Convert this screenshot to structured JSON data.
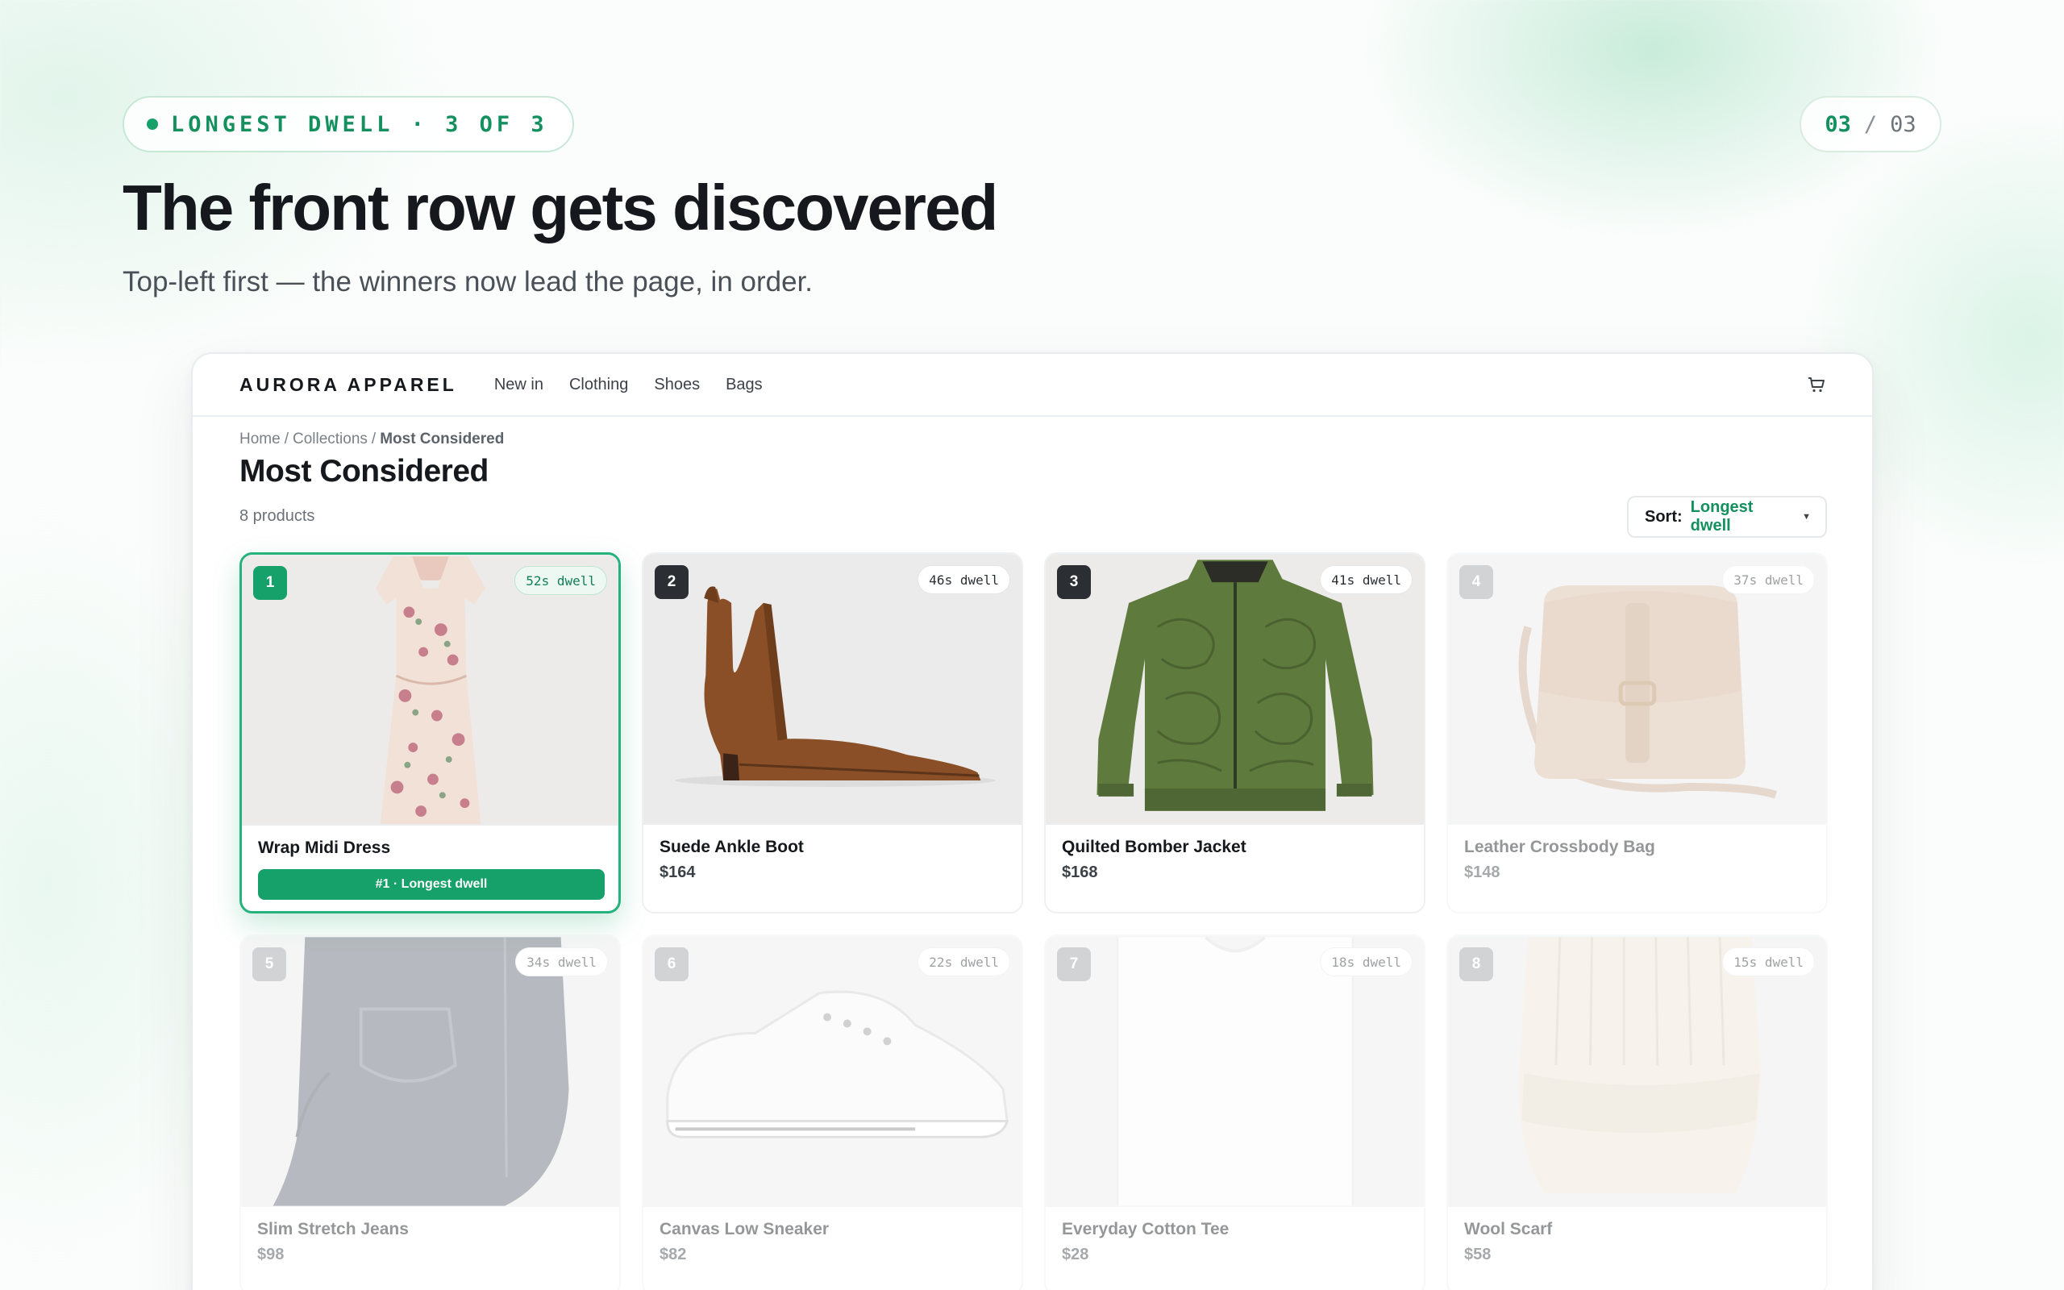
{
  "hero": {
    "step_label": "LONGEST DWELL · 3 OF 3",
    "counter_current": "03",
    "counter_separator": "/",
    "counter_total": "03",
    "title": "The front row gets discovered",
    "subtitle": "Top-left first — the winners now lead the page, in order."
  },
  "shop": {
    "brand": "AURORA APPAREL",
    "nav": [
      "New in",
      "Clothing",
      "Shoes",
      "Bags"
    ],
    "cart_icon": "cart-icon",
    "breadcrumb": [
      "Home",
      "Collections",
      "Most Considered"
    ],
    "breadcrumb_separator": "/",
    "page_title": "Most Considered",
    "product_count": "8 products",
    "sort_label": "Sort:",
    "sort_value": "Longest dwell",
    "products": [
      {
        "rank": "1",
        "dwell": "52s dwell",
        "name": "Wrap Midi Dress",
        "price": "",
        "tag": "#1 · Longest dwell",
        "image": "floral-dress"
      },
      {
        "rank": "2",
        "dwell": "46s dwell",
        "name": "Suede Ankle Boot",
        "price": "$164",
        "image": "ankle-boot"
      },
      {
        "rank": "3",
        "dwell": "41s dwell",
        "name": "Quilted Bomber Jacket",
        "price": "$168",
        "image": "bomber-jacket"
      },
      {
        "rank": "4",
        "dwell": "37s dwell",
        "name": "Leather Crossbody Bag",
        "price": "$148",
        "image": "crossbody-bag"
      },
      {
        "rank": "5",
        "dwell": "34s dwell",
        "name": "Slim Stretch Jeans",
        "price": "$98",
        "image": "jeans"
      },
      {
        "rank": "6",
        "dwell": "22s dwell",
        "name": "Canvas Low Sneaker",
        "price": "$82",
        "image": "sneaker"
      },
      {
        "rank": "7",
        "dwell": "18s dwell",
        "name": "Everyday Cotton Tee",
        "price": "$28",
        "image": "tee"
      },
      {
        "rank": "8",
        "dwell": "15s dwell",
        "name": "Wool Scarf",
        "price": "$58",
        "image": "scarf"
      }
    ]
  },
  "colors": {
    "accent_green": "#16a06a",
    "text_dark": "#15181c"
  }
}
